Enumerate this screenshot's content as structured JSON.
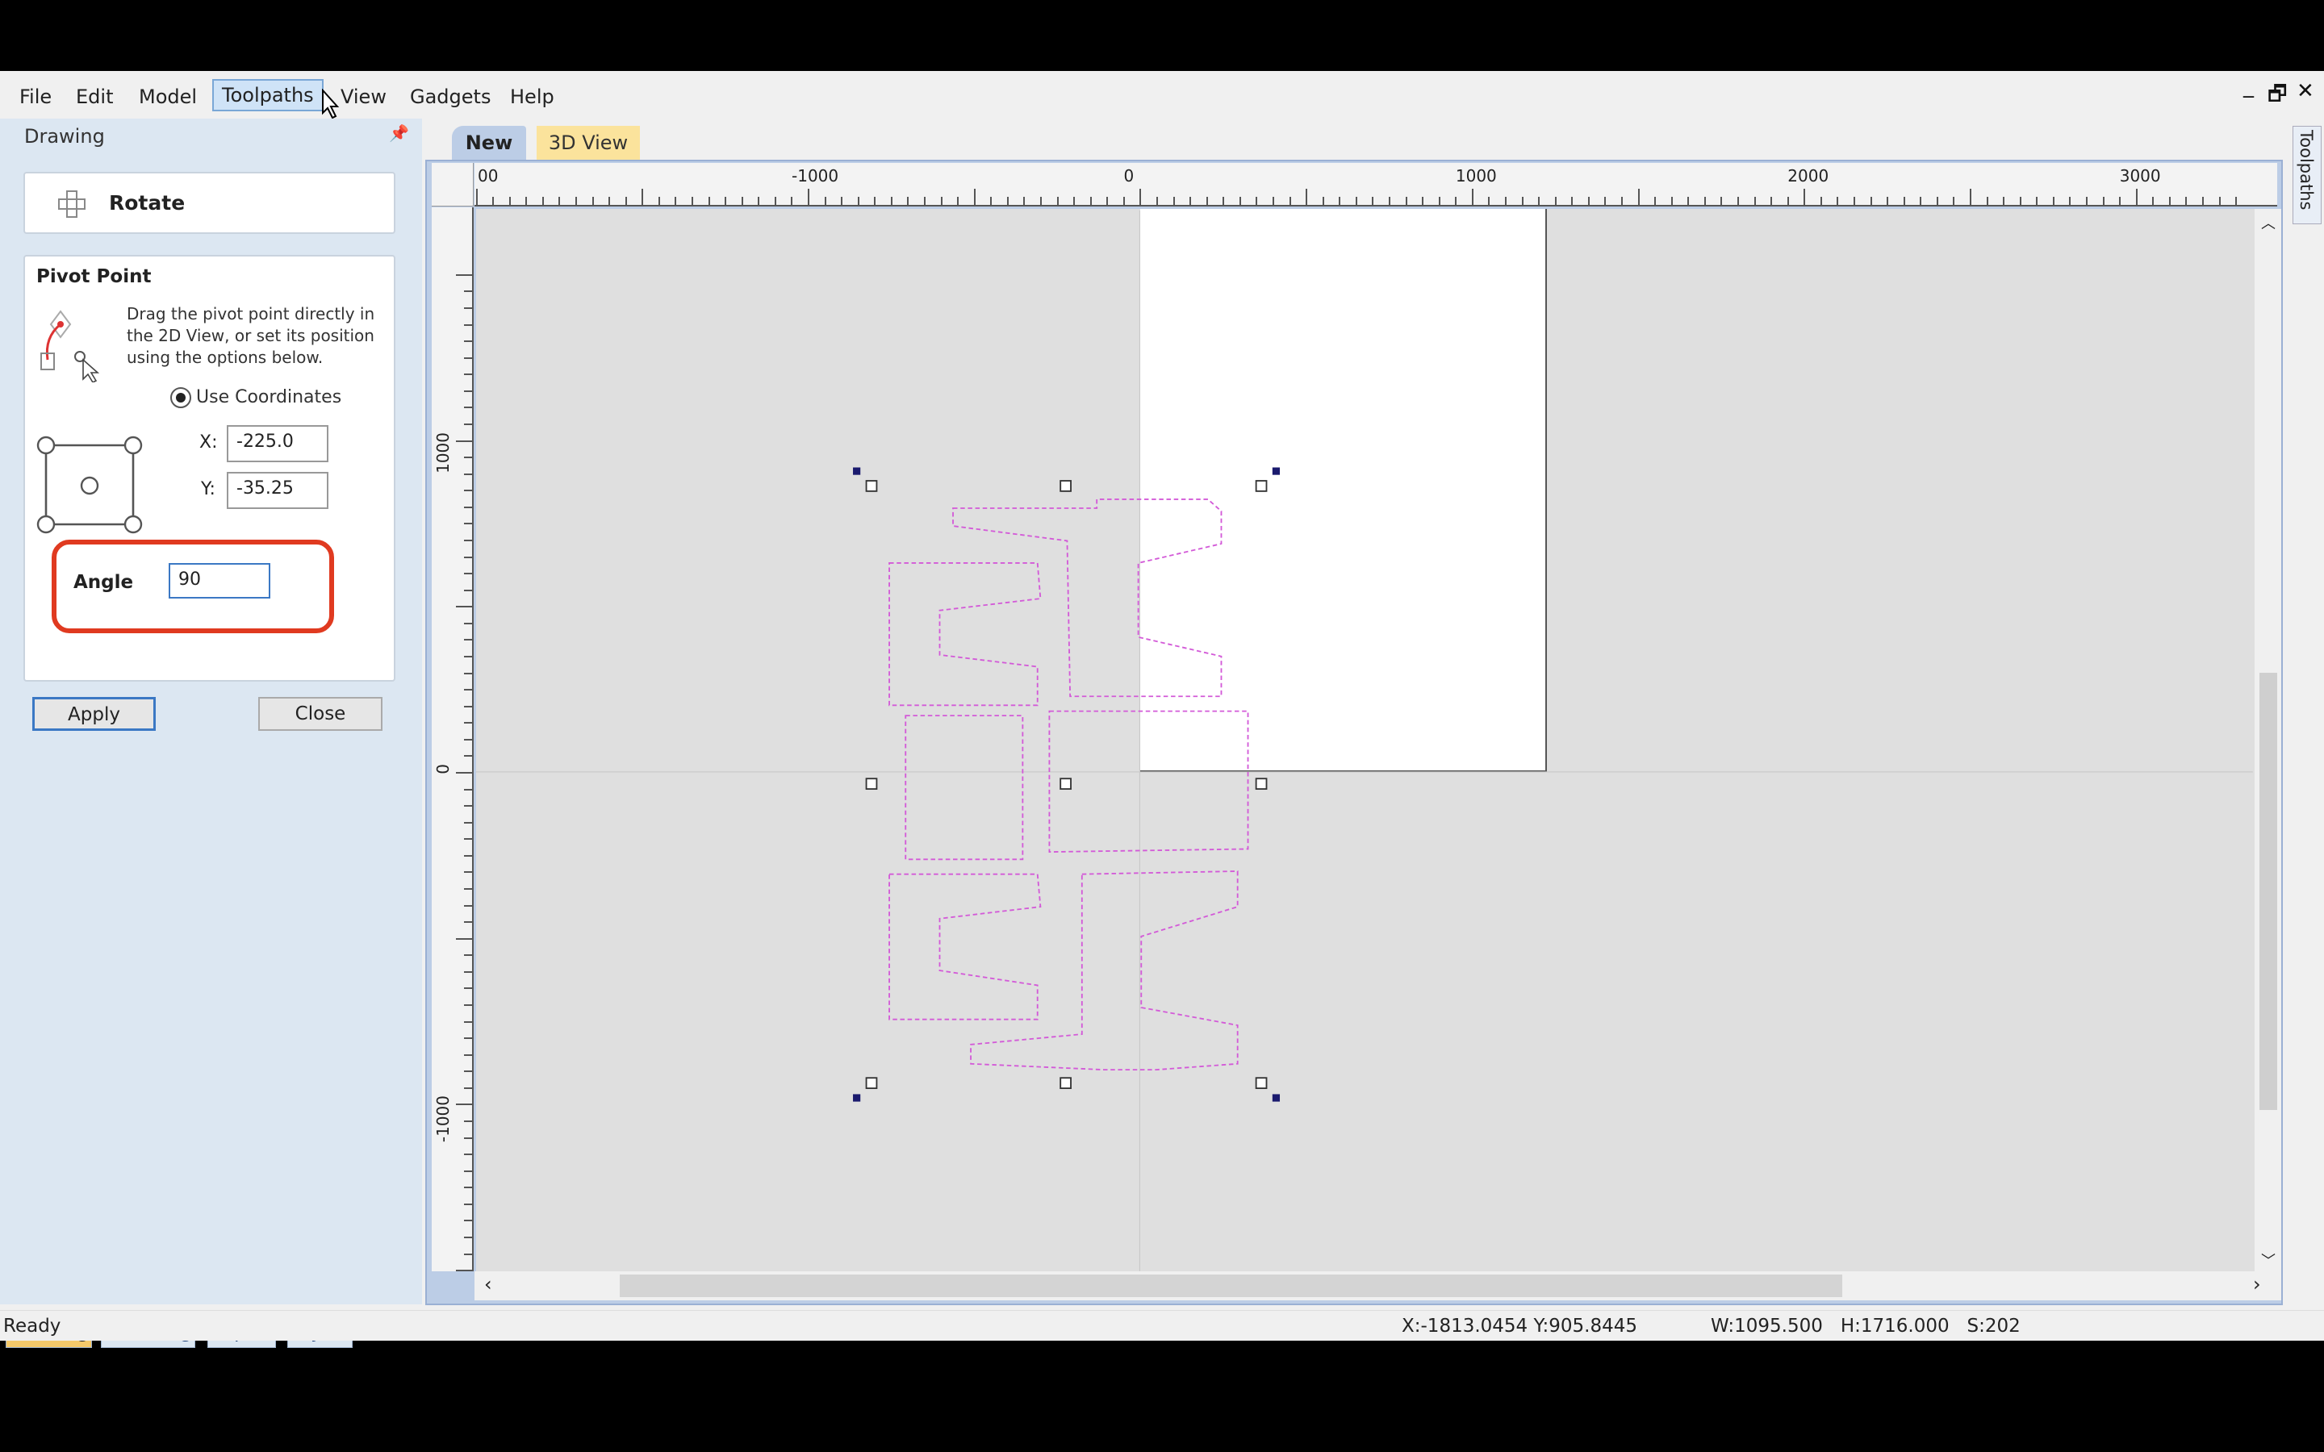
{
  "menu": {
    "items": [
      "File",
      "Edit",
      "Model",
      "Toolpaths",
      "View",
      "Gadgets",
      "Help"
    ],
    "active": "Toolpaths"
  },
  "window_controls": {
    "minimize": "_",
    "restore": "🗗",
    "close": "✕"
  },
  "panel": {
    "title": "Drawing",
    "pin_icon": "pin-icon",
    "tool": {
      "icon": "rotate-icon",
      "label": "Rotate"
    },
    "pivot": {
      "heading": "Pivot Point",
      "description": "Drag the pivot point directly in the 2D View, or set its position using the options below.",
      "use_coordinates_label": "Use Coordinates",
      "use_coordinates_checked": true,
      "x_label": "X:",
      "x_value": "-225.0",
      "y_label": "Y:",
      "y_value": "-35.25",
      "angle_label": "Angle",
      "angle_value": "90"
    },
    "apply_label": "Apply",
    "close_label": "Close",
    "bottom_tabs": [
      "Drawing",
      "Modeling",
      "Clipart",
      "Layers"
    ],
    "active_bottom_tab": "Drawing"
  },
  "viewport": {
    "tabs": [
      "New",
      "3D View"
    ],
    "active_tab": "New",
    "side_tab": "Toolpaths",
    "ruler_top_labels": [
      "00",
      "-1000",
      "0",
      "1000",
      "2000",
      "3000"
    ],
    "ruler_left_labels": [
      "1000",
      "0",
      "-1000"
    ],
    "vector_color": "#d35ad8",
    "highlight_color": "#e03a20"
  },
  "status": {
    "state": "Ready",
    "cursor": "X:-1813.0454 Y:905.8445",
    "size": "W:1095.500   H:1716.000   S:202"
  }
}
